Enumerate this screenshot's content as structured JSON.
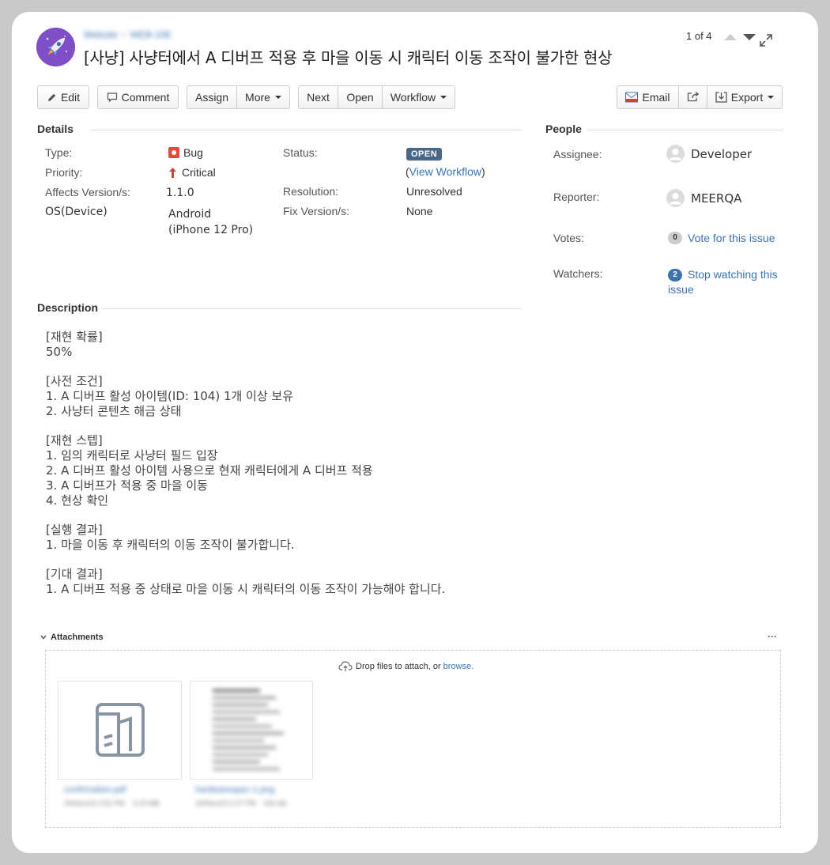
{
  "header": {
    "project": "Website",
    "issue_key": "WEB-106",
    "title": "[사냥] 사냥터에서 A 디버프 적용 후 마을 이동 시 캐릭터 이동 조작이 불가한 현상",
    "pager": "1 of 4"
  },
  "toolbar": {
    "edit": "Edit",
    "comment": "Comment",
    "assign": "Assign",
    "more": "More",
    "next": "Next",
    "open": "Open",
    "workflow": "Workflow",
    "email": "Email",
    "export": "Export"
  },
  "details": {
    "heading": "Details",
    "type_label": "Type:",
    "type_value": "Bug",
    "priority_label": "Priority:",
    "priority_value": "Critical",
    "affects_label": "Affects Version/s:",
    "affects_value": "1.1.0",
    "os_label": "OS(Device)",
    "os_value_1": "Android",
    "os_value_2": "(iPhone 12 Pro)",
    "status_label": "Status:",
    "status_value": "OPEN",
    "view_workflow": "View Workflow",
    "resolution_label": "Resolution:",
    "resolution_value": "Unresolved",
    "fix_label": "Fix Version/s:",
    "fix_value": "None"
  },
  "people": {
    "heading": "People",
    "assignee_label": "Assignee:",
    "assignee_value": "Developer",
    "reporter_label": "Reporter:",
    "reporter_value": "MEERQA",
    "votes_label": "Votes:",
    "votes_count": "0",
    "votes_link": "Vote for this issue",
    "watchers_label": "Watchers:",
    "watchers_count": "2",
    "watchers_link_1": "Stop watching this",
    "watchers_link_2": "issue"
  },
  "description": {
    "heading": "Description",
    "blocks": [
      [
        "[재현 확률]",
        "50%"
      ],
      [
        "[사전 조건]",
        "1. A 디버프 활성 아이템(ID: 104) 1개 이상 보유",
        "2. 사냥터 콘텐츠 해금 상태"
      ],
      [
        "[재현 스텝]",
        "1. 임의 캐릭터로 사냥터 필드 입장",
        "2. A 디버프 활성 아이템 사용으로 현재 캐릭터에게 A 디버프 적용",
        "3. A 디버프가 적용 중 마을 이동",
        "4. 현상 확인"
      ],
      [
        "[실행 결과]",
        "1. 마을 이동 후 캐릭터의 이동 조작이 불가합니다."
      ],
      [
        "[기대 결과]",
        "1. A 디버프 적용 중 상태로 마을 이동 시 캐릭터의 이동 조작이 가능해야 합니다."
      ]
    ]
  },
  "attachments": {
    "heading": "Attachments",
    "more": "···",
    "drop_text": "Drop files to attach, or",
    "browse": "browse.",
    "files": [
      {
        "name": "confirmation.pdf",
        "date": "24/Nov/23 2:51 PM",
        "size": "3.23 MB"
      },
      {
        "name": "hardwarespec-1.png",
        "date": "24/Nov/23 2:37 PM",
        "size": "632 kB"
      }
    ]
  },
  "colors": {
    "link": "#3b73af",
    "status_lozenge": "#4a6785",
    "bug_red": "#e5493a",
    "critical_red": "#d04437"
  }
}
